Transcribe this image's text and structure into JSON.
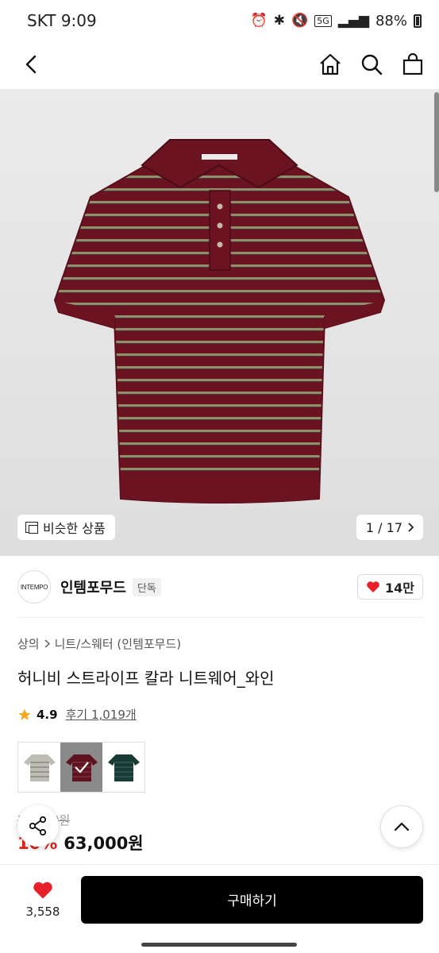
{
  "status_bar": {
    "carrier_time": "SKT 9:09",
    "battery": "88%",
    "network": "5G",
    "icons": [
      "alarm-icon",
      "bluetooth-icon",
      "mute-icon",
      "signal-icon",
      "battery-icon"
    ]
  },
  "nav": {
    "icons": [
      "back-icon",
      "home-icon",
      "search-icon",
      "shopping-bag-icon"
    ]
  },
  "gallery": {
    "similar_label": "비슷한 상품",
    "counter": "1 / 17",
    "image_description": "wine striped knit polo short-sleeve",
    "colors": {
      "knit": "#6b1320",
      "stripe": "#8f8f6e",
      "background": "#e5e5e5"
    }
  },
  "brand": {
    "logo_text": "INTEMPO",
    "name": "인템포무드",
    "badge": "단독",
    "likes": "14만"
  },
  "product": {
    "breadcrumb": [
      "상의",
      "니트/스웨터 (인템포무드)"
    ],
    "title": "허니비 스트라이프 칼라 니트웨어_와인",
    "rating": "4.9",
    "reviews": "후기 1,019개",
    "variants": [
      {
        "color": "#bdbdb4",
        "selected": false
      },
      {
        "color": "#5e1420",
        "selected": true
      },
      {
        "color": "#173a34",
        "selected": false
      }
    ],
    "original_price": "70,000원",
    "discount": "10%",
    "price": "63,000원"
  },
  "bottom": {
    "wish_count": "3,558",
    "buy_label": "구매하기"
  },
  "theme": {
    "accent": "#000000",
    "discount_red": "#e2231a",
    "heart_red": "#e8202a"
  }
}
